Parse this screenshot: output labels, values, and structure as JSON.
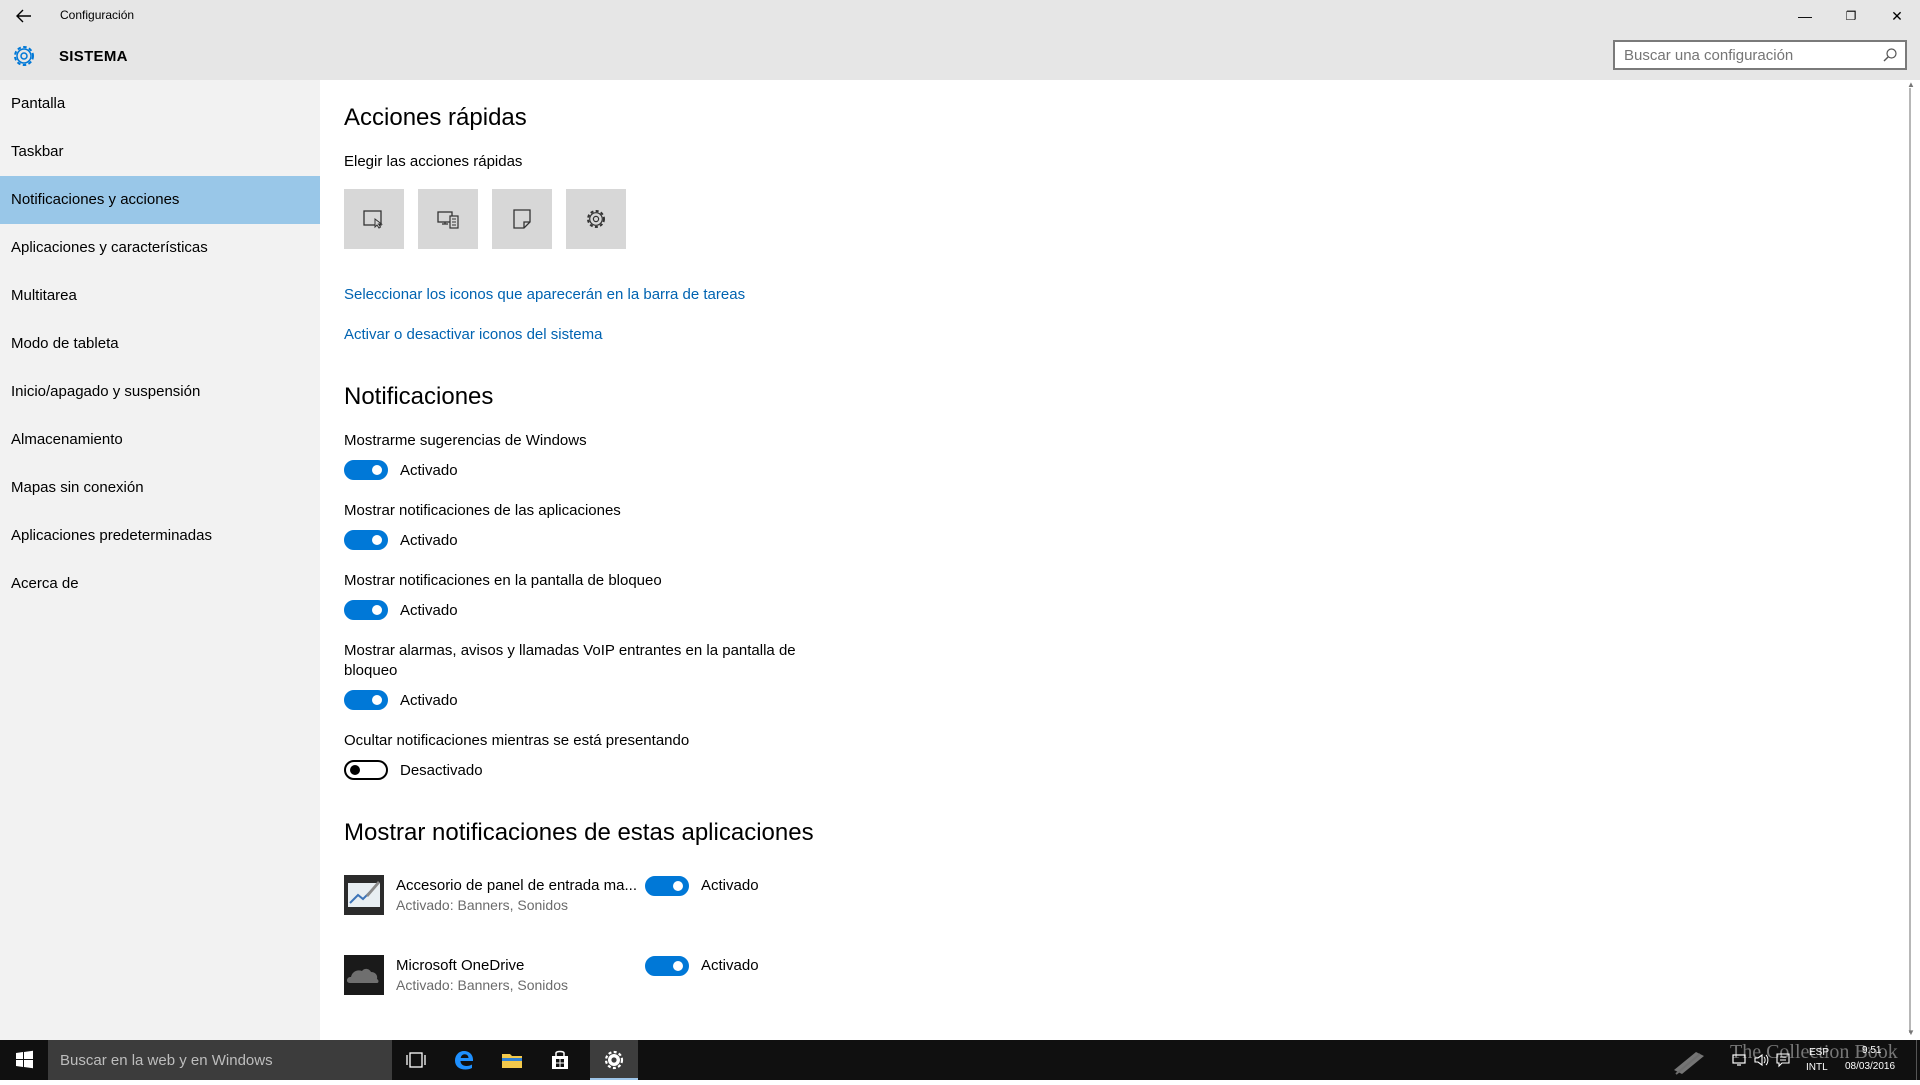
{
  "window": {
    "title": "Configuración",
    "back_icon": "back-arrow-icon",
    "minimize_glyph": "—",
    "maximize_glyph": "❐",
    "close_glyph": "✕"
  },
  "header": {
    "section_title": "SISTEMA",
    "search_placeholder": "Buscar una configuración"
  },
  "sidebar": {
    "items": [
      {
        "label": "Pantalla",
        "active": false
      },
      {
        "label": "Taskbar",
        "active": false
      },
      {
        "label": "Notificaciones y acciones",
        "active": true
      },
      {
        "label": "Aplicaciones y características",
        "active": false
      },
      {
        "label": "Multitarea",
        "active": false
      },
      {
        "label": "Modo de tableta",
        "active": false
      },
      {
        "label": "Inicio/apagado y suspensión",
        "active": false
      },
      {
        "label": "Almacenamiento",
        "active": false
      },
      {
        "label": "Mapas sin conexión",
        "active": false
      },
      {
        "label": "Aplicaciones predeterminadas",
        "active": false
      },
      {
        "label": "Acerca de",
        "active": false
      }
    ]
  },
  "quick_actions": {
    "heading": "Acciones rápidas",
    "subheading": "Elegir las acciones rápidas",
    "tiles": [
      "tablet-mode-icon",
      "project-icon",
      "note-icon",
      "settings-icon"
    ],
    "link_taskbar_icons": "Seleccionar los iconos que aparecerán en la barra de tareas",
    "link_system_icons": "Activar o desactivar iconos del sistema"
  },
  "notifications": {
    "heading": "Notificaciones",
    "settings": [
      {
        "label": "Mostrarme sugerencias de Windows",
        "state": "Activado",
        "on": true
      },
      {
        "label": "Mostrar notificaciones de las aplicaciones",
        "state": "Activado",
        "on": true
      },
      {
        "label": "Mostrar notificaciones en la pantalla de bloqueo",
        "state": "Activado",
        "on": true
      },
      {
        "label_line1": "Mostrar alarmas, avisos y llamadas VoIP entrantes en la pantalla de",
        "label_line2": "bloqueo",
        "state": "Activado",
        "on": true
      },
      {
        "label": "Ocultar notificaciones mientras se está presentando",
        "state": "Desactivado",
        "on": false
      }
    ]
  },
  "apps_section": {
    "heading": "Mostrar notificaciones de estas aplicaciones",
    "apps": [
      {
        "name": "Accesorio de panel de entrada ma...",
        "sub": "Activado: Banners, Sonidos",
        "state": "Activado",
        "on": true,
        "icon": "pen-input-icon"
      },
      {
        "name": "Microsoft OneDrive",
        "sub": "Activado: Banners, Sonidos",
        "state": "Activado",
        "on": true,
        "icon": "onedrive-icon"
      }
    ]
  },
  "taskbar": {
    "search_placeholder": "Buscar en la web y en Windows",
    "icons": [
      "task-view-icon",
      "edge-icon",
      "file-explorer-icon",
      "store-icon",
      "settings-icon"
    ],
    "language_top": "ESP",
    "language_bottom": "INTL",
    "time": "9:51",
    "date": "08/03/2016"
  },
  "watermark": "The Collection Book",
  "colors": {
    "accent": "#0078d7",
    "link": "#0063b1",
    "nav_active": "#99c7e8",
    "sidebar_bg": "#f2f2f2",
    "titlebar_bg": "#e6e6e6",
    "taskbar_bg": "#101010"
  }
}
